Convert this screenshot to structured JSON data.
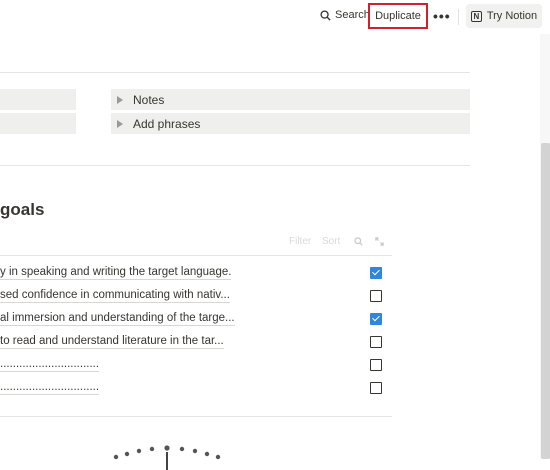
{
  "topbar": {
    "search_label": "Search",
    "duplicate_label": "Duplicate",
    "more_label": "•••",
    "try_notion_label": "Try Notion",
    "notion_logo_letter": "N"
  },
  "toggles": [
    {
      "label": "Notes"
    },
    {
      "label": "Add phrases"
    }
  ],
  "goals": {
    "heading": "goals",
    "filter_label": "Filter",
    "sort_label": "Sort",
    "rows": [
      {
        "text": "y in speaking and writing the target language.",
        "checked": true
      },
      {
        "text": "sed confidence in communicating with nativ...",
        "checked": false
      },
      {
        "text": "al immersion and understanding of the targe...",
        "checked": true
      },
      {
        "text": " to read and understand literature in the tar...",
        "checked": false
      },
      {
        "text": "...............................",
        "checked": false
      },
      {
        "text": "...............................",
        "checked": false
      }
    ]
  },
  "colors": {
    "accent": "#2e86de",
    "highlight_border": "#d0202a",
    "text": "#37352f"
  }
}
